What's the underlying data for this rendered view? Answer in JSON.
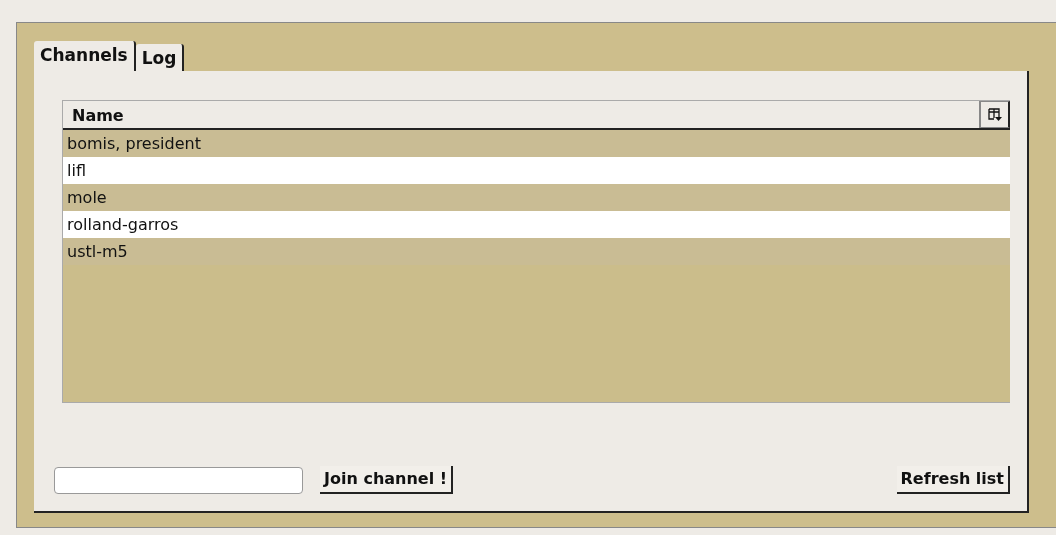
{
  "tabs": [
    {
      "label": "Channels",
      "selected": true
    },
    {
      "label": "Log",
      "selected": false
    }
  ],
  "table": {
    "columns": [
      "Name"
    ],
    "rows": [
      {
        "name": "bomis, president"
      },
      {
        "name": "lifl"
      },
      {
        "name": "mole"
      },
      {
        "name": "rolland-garros"
      },
      {
        "name": "ustl-m5"
      }
    ]
  },
  "buttons": {
    "join": "Join channel !",
    "refresh": "Refresh list"
  }
}
